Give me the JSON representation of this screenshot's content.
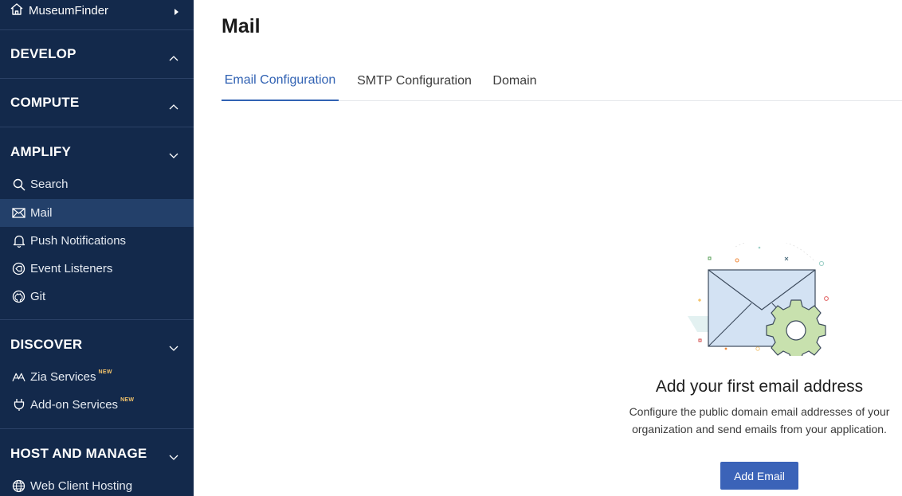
{
  "sidebar": {
    "project": "MuseumFinder",
    "sections": {
      "develop": "DEVELOP",
      "compute": "COMPUTE",
      "amplify": "AMPLIFY",
      "discover": "DISCOVER",
      "host": "HOST AND MANAGE"
    },
    "amplify_items": [
      "Search",
      "Mail",
      "Push Notifications",
      "Event Listeners",
      "Git"
    ],
    "discover_items": [
      "Zia Services",
      "Add-on Services"
    ],
    "new_badge": "NEW",
    "host_items": [
      "Web Client Hosting"
    ],
    "active_item": "Mail"
  },
  "main": {
    "title": "Mail",
    "tabs": [
      "Email Configuration",
      "SMTP Configuration",
      "Domain"
    ],
    "active_tab": "Email Configuration",
    "empty_state": {
      "title": "Add your first email address",
      "description": "Configure the public domain email addresses of your organization and send emails from your application.",
      "button": "Add Email"
    }
  },
  "colors": {
    "sidebar_bg": "#13294b",
    "sidebar_active": "#23406a",
    "accent": "#3162b3",
    "button": "#3b63b8",
    "new_badge": "#f2c36b"
  },
  "icons": {
    "project": "home-icon",
    "search": "search-icon",
    "mail": "mail-icon",
    "push": "bell-icon",
    "events": "event-icon",
    "git": "github-icon",
    "zia": "zia-icon",
    "addon": "plug-icon",
    "hosting": "globe-icon"
  }
}
